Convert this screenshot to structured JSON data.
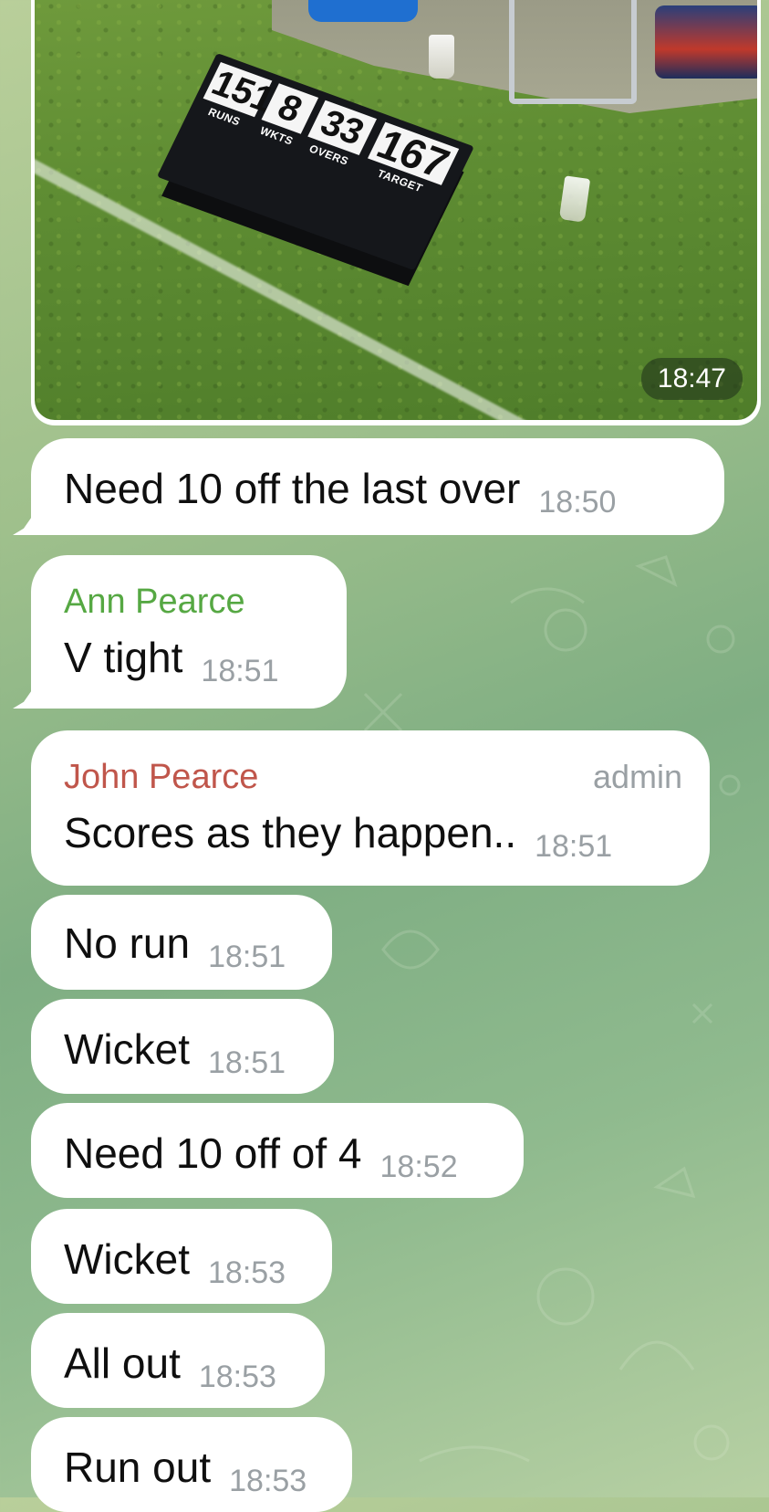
{
  "colors": {
    "sender_ann": "#56a843",
    "sender_john": "#c0564b",
    "bubble": "#ffffff",
    "timestamp": "#9aa0a4",
    "chat_background": "#8fba8e"
  },
  "photo_message": {
    "scoreboard": {
      "runs": "151",
      "runs_label": "RUNS",
      "wkts": "8",
      "wkts_label": "WKTS",
      "overs": "33",
      "overs_label": "OVERS",
      "target": "167",
      "target_label": "TARGET"
    },
    "time": "18:47"
  },
  "messages": [
    {
      "text": "Need 10 off the last over",
      "time": "18:50"
    },
    {
      "sender": "Ann Pearce",
      "text": "V tight",
      "time": "18:51"
    },
    {
      "sender": "John Pearce",
      "badge": "admin",
      "text": "Scores as they happen..",
      "time": "18:51"
    },
    {
      "text": "No run",
      "time": "18:51"
    },
    {
      "text": "Wicket",
      "time": "18:51"
    },
    {
      "text": "Need 10 off of 4",
      "time": "18:52"
    },
    {
      "text": "Wicket",
      "time": "18:53"
    },
    {
      "text": "All out",
      "time": "18:53"
    },
    {
      "text": "Run out",
      "time": "18:53"
    }
  ]
}
